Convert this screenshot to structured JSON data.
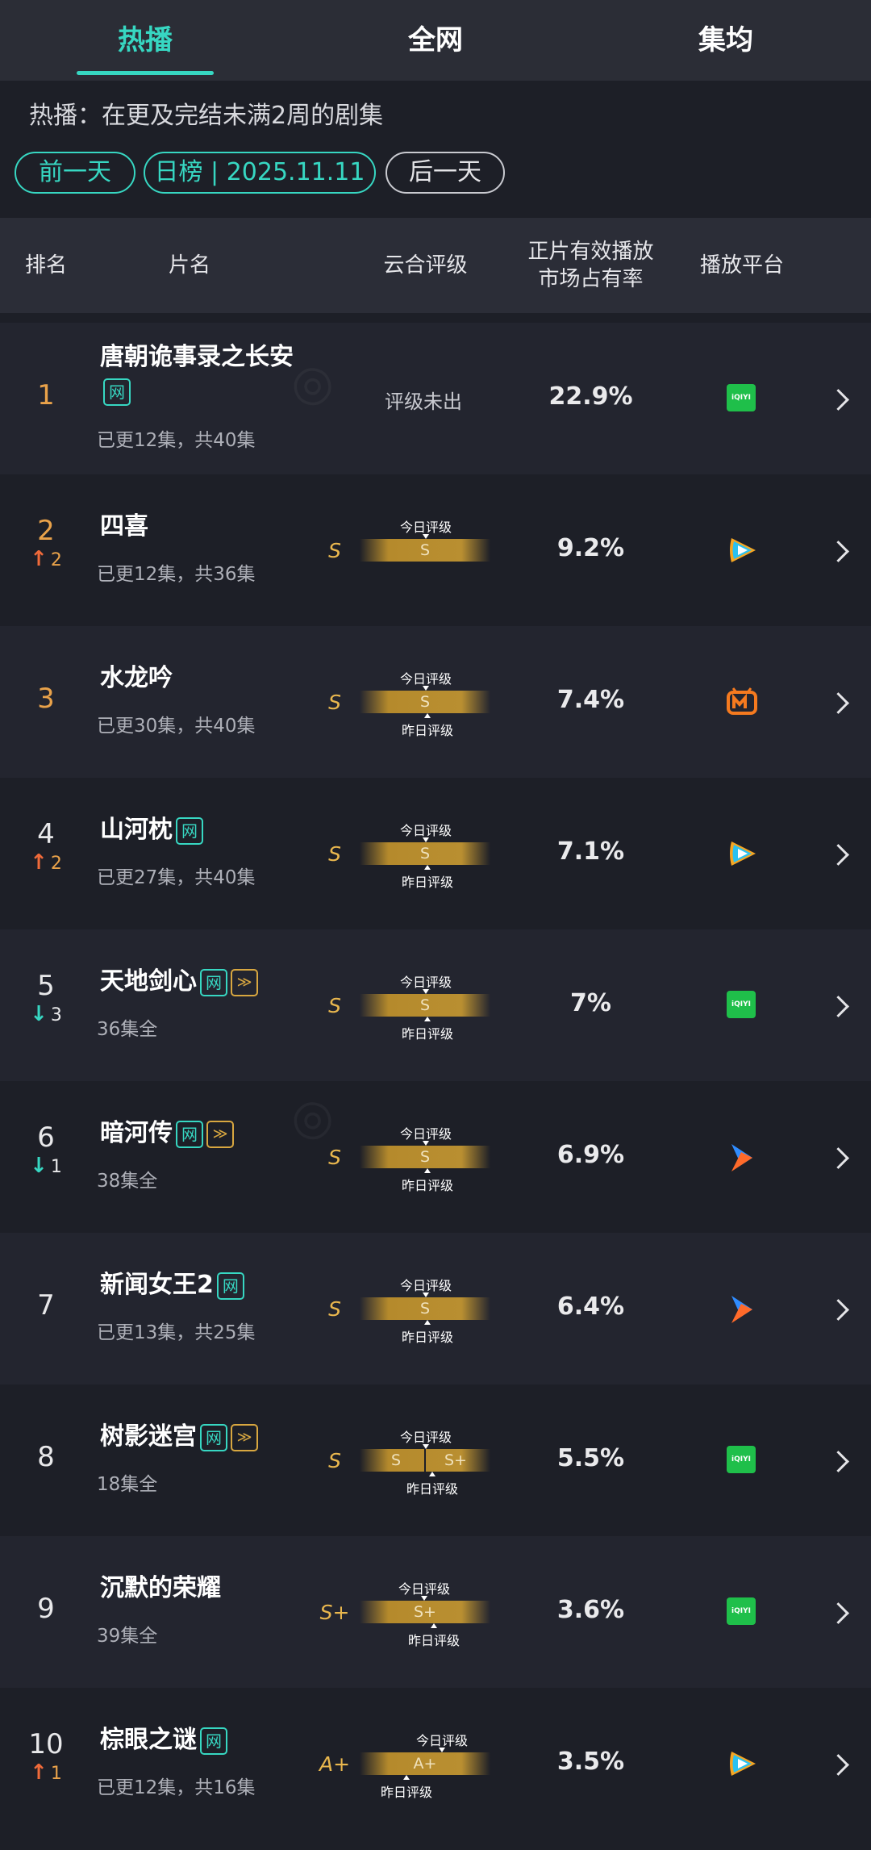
{
  "tabs": [
    {
      "label": "热播"
    },
    {
      "label": "全网"
    },
    {
      "label": "集均"
    }
  ],
  "description": "热播：在更及完结未满2周的剧集",
  "date_nav": {
    "prev": "前一天",
    "current": "日榜 | 2025.11.11",
    "next": "后一天"
  },
  "columns": {
    "rank": "排名",
    "title": "片名",
    "grade": "云合评级",
    "share_line1": "正片有效播放",
    "share_line2": "市场占有率",
    "platform": "播放平台"
  },
  "grade_labels": {
    "today": "今日评级",
    "yesterday": "昨日评级"
  },
  "rows": [
    {
      "rank": "1",
      "title": "唐朝诡事录之长安",
      "badges": [
        "网"
      ],
      "episodes": "已更12集，共40集",
      "grade": "",
      "grade_text": "评级未出",
      "share": "22.9%",
      "platform": "iqiyi",
      "change": ""
    },
    {
      "rank": "2",
      "title": "四喜",
      "badges": [],
      "episodes": "已更12集，共36集",
      "grade": "S",
      "bar_text": "S",
      "share": "9.2%",
      "platform": "tencent-video",
      "change": "2",
      "direction": "up"
    },
    {
      "rank": "3",
      "title": "水龙吟",
      "badges": [],
      "episodes": "已更30集，共40集",
      "grade": "S",
      "bar_text": "S",
      "share": "7.4%",
      "platform": "mango-tv",
      "change": ""
    },
    {
      "rank": "4",
      "title": "山河枕",
      "badges": [
        "网"
      ],
      "episodes": "已更27集，共40集",
      "grade": "S",
      "bar_text": "S",
      "share": "7.1%",
      "platform": "tencent-video",
      "change": "2",
      "direction": "up"
    },
    {
      "rank": "5",
      "title": "天地剑心",
      "badges": [
        "网",
        "≫"
      ],
      "episodes": "36集全",
      "grade": "S",
      "bar_text": "S",
      "share": "7%",
      "platform": "iqiyi",
      "change": "3",
      "direction": "down"
    },
    {
      "rank": "6",
      "title": "暗河传",
      "badges": [
        "网",
        "≫"
      ],
      "episodes": "38集全",
      "grade": "S",
      "bar_text": "S",
      "share": "6.9%",
      "platform": "youku",
      "change": "1",
      "direction": "down"
    },
    {
      "rank": "7",
      "title": "新闻女王2",
      "badges": [
        "网"
      ],
      "episodes": "已更13集，共25集",
      "grade": "S",
      "bar_text": "S",
      "share": "6.4%",
      "platform": "youku",
      "change": ""
    },
    {
      "rank": "8",
      "title": "树影迷宫",
      "badges": [
        "网",
        "≫"
      ],
      "episodes": "18集全",
      "grade": "S",
      "bar_text": "S",
      "bar_text2": "S+",
      "share": "5.5%",
      "platform": "iqiyi",
      "change": ""
    },
    {
      "rank": "9",
      "title": "沉默的荣耀",
      "badges": [],
      "episodes": "39集全",
      "grade": "S+",
      "bar_text": "S+",
      "share": "3.6%",
      "platform": "iqiyi",
      "change": ""
    },
    {
      "rank": "10",
      "title": "棕眼之谜",
      "badges": [
        "网"
      ],
      "episodes": "已更12集，共16集",
      "grade": "A+",
      "bar_text": "A+",
      "share": "3.5%",
      "platform": "tencent-video",
      "change": "1",
      "direction": "up"
    }
  ],
  "platform_labels": {
    "iqiyi": "iQIYI"
  },
  "colors": {
    "accent": "#37d7c2",
    "gold": "#e9b74e",
    "up": "#ef6a3a",
    "down": "#37d7c2"
  }
}
